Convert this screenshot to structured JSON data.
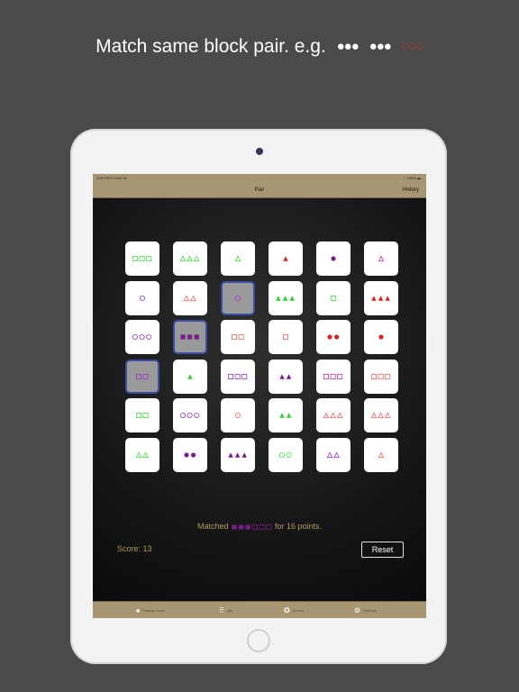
{
  "headline": {
    "text": "Match same block pair. e.g.",
    "example_a": "●●●",
    "example_b": "●●●",
    "example_c": "○○○"
  },
  "statusbar": {
    "left": "2:53 PM   Fri Oct 16",
    "right": "⌔  100% ▬"
  },
  "navbar": {
    "title": "Pair",
    "history": "History"
  },
  "board": {
    "rows": [
      [
        {
          "shape": "square",
          "fill": "outline",
          "count": 3,
          "color": "#44dd44"
        },
        {
          "shape": "triangle",
          "fill": "outline",
          "count": 3,
          "color": "#44dd44"
        },
        {
          "shape": "triangle",
          "fill": "outline",
          "count": 1,
          "color": "#44dd44"
        },
        {
          "shape": "triangle",
          "fill": "solid",
          "count": 1,
          "color": "#dd2222"
        },
        {
          "shape": "circle",
          "fill": "solid",
          "count": 1,
          "color": "#7a1d8a"
        },
        {
          "shape": "triangle",
          "fill": "outline",
          "count": 1,
          "color": "#cc3399"
        }
      ],
      [
        {
          "shape": "circle",
          "fill": "outline",
          "count": 1,
          "color": "#9933cc"
        },
        {
          "shape": "triangle",
          "fill": "outline",
          "count": 2,
          "color": "#ee6666"
        },
        {
          "shape": "circle",
          "fill": "outline",
          "count": 1,
          "color": "#9933cc",
          "selected": true
        },
        {
          "shape": "triangle",
          "fill": "solid",
          "count": 3,
          "color": "#33cc33"
        },
        {
          "shape": "square",
          "fill": "outline",
          "count": 1,
          "color": "#44dd44"
        },
        {
          "shape": "triangle",
          "fill": "solid",
          "count": 3,
          "color": "#dd2222"
        }
      ],
      [
        {
          "shape": "circle",
          "fill": "outline",
          "count": 3,
          "color": "#9933cc"
        },
        {
          "shape": "square",
          "fill": "solid",
          "count": 3,
          "color": "#7a1d8a",
          "selected": true
        },
        {
          "shape": "square",
          "fill": "outline",
          "count": 2,
          "color": "#ee6666"
        },
        {
          "shape": "square",
          "fill": "outline",
          "count": 1,
          "color": "#ee6666"
        },
        {
          "shape": "circle",
          "fill": "solid",
          "count": 2,
          "color": "#dd2222"
        },
        {
          "shape": "circle",
          "fill": "solid",
          "count": 1,
          "color": "#dd2222"
        }
      ],
      [
        {
          "shape": "square",
          "fill": "outline",
          "count": 2,
          "color": "#9933cc",
          "selected": true
        },
        {
          "shape": "triangle",
          "fill": "solid",
          "count": 1,
          "color": "#33cc33"
        },
        {
          "shape": "square",
          "fill": "outline",
          "count": 3,
          "color": "#9933cc"
        },
        {
          "shape": "triangle",
          "fill": "solid",
          "count": 2,
          "color": "#7a1d8a"
        },
        {
          "shape": "square",
          "fill": "outline",
          "count": 3,
          "color": "#cc3399"
        },
        {
          "shape": "square",
          "fill": "outline",
          "count": 3,
          "color": "#ee6666"
        }
      ],
      [
        {
          "shape": "square",
          "fill": "outline",
          "count": 2,
          "color": "#44dd44"
        },
        {
          "shape": "circle",
          "fill": "outline",
          "count": 3,
          "color": "#9933cc"
        },
        {
          "shape": "circle",
          "fill": "outline",
          "count": 1,
          "color": "#ee6666"
        },
        {
          "shape": "triangle",
          "fill": "solid",
          "count": 2,
          "color": "#33cc33"
        },
        {
          "shape": "triangle",
          "fill": "outline",
          "count": 3,
          "color": "#ee6666"
        },
        {
          "shape": "triangle",
          "fill": "outline",
          "count": 3,
          "color": "#ee6666"
        }
      ],
      [
        {
          "shape": "triangle",
          "fill": "outline",
          "count": 2,
          "color": "#44dd44"
        },
        {
          "shape": "circle",
          "fill": "solid",
          "count": 2,
          "color": "#7a1d8a"
        },
        {
          "shape": "triangle",
          "fill": "solid",
          "count": 3,
          "color": "#7a1d8a"
        },
        {
          "shape": "circle",
          "fill": "outline",
          "count": 2,
          "color": "#44dd44"
        },
        {
          "shape": "triangle",
          "fill": "outline",
          "count": 2,
          "color": "#9933cc"
        },
        {
          "shape": "triangle",
          "fill": "outline",
          "count": 1,
          "color": "#ee6666"
        }
      ]
    ]
  },
  "matched": {
    "prefix": "Matched",
    "suffix": "for 16 points.",
    "glyph_a": {
      "shape": "square",
      "fill": "solid",
      "count": 3,
      "color": "#7a1d8a"
    },
    "glyph_b": {
      "shape": "square",
      "fill": "outline",
      "count": 3,
      "color": "#7a1d8a"
    }
  },
  "score": {
    "text": "Score: 13"
  },
  "reset_label": "Reset",
  "tabs": [
    {
      "label": "Playing Cards",
      "icon": "cards-icon",
      "glyph": "♠"
    },
    {
      "label": "pair",
      "icon": "dots-icon",
      "glyph": "⠿"
    },
    {
      "label": "Scores",
      "icon": "ribbon-icon",
      "glyph": "✪"
    },
    {
      "label": "Settings",
      "icon": "gear-icon",
      "glyph": "⚙"
    }
  ]
}
